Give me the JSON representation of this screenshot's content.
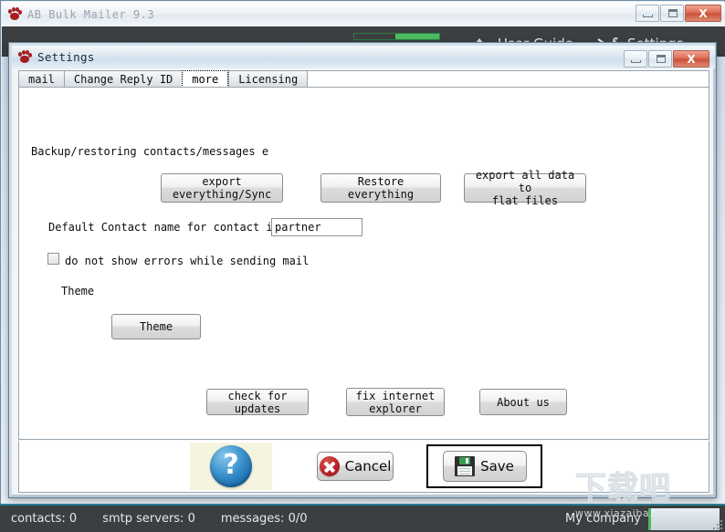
{
  "main_window": {
    "title": "AB Bulk Mailer 9.3",
    "icon": "paw-icon",
    "minimize_label": "",
    "maximize_label": "",
    "close_label": "X"
  },
  "toolbar": {
    "items": [
      {
        "label": "User Guide",
        "icon": "mountain-icon"
      },
      {
        "label": "Settings",
        "icon": "wrench-icon"
      }
    ],
    "progress_percent": 50,
    "progress_color": "#4cb963"
  },
  "dialog": {
    "title": "Settings",
    "icon": "paw-icon",
    "close_label": "X",
    "tabs": [
      {
        "label": "mail",
        "selected": false
      },
      {
        "label": "Change Reply ID",
        "selected": false
      },
      {
        "label": "more",
        "selected": true
      },
      {
        "label": "Licensing",
        "selected": false
      }
    ],
    "content": {
      "backup_label": "Backup/restoring contacts/messages e",
      "buttons_row1": [
        {
          "label": "export\neverything/Sync"
        },
        {
          "label": "Restore everything"
        },
        {
          "label": "export all data to\nflat files"
        }
      ],
      "default_contact_label": "Default Contact name for contact imports",
      "default_contact_value": "partner",
      "default_contact_placeholder": "",
      "checkbox_label": "do not show errors while sending mail",
      "checkbox_checked": false,
      "theme_label": "Theme",
      "theme_button": "Theme",
      "buttons_row2": [
        {
          "label": "check for updates"
        },
        {
          "label": "fix internet\nexplorer"
        },
        {
          "label": "About us"
        }
      ]
    },
    "footer": {
      "help_icon": "question-mark-icon",
      "help_symbol": "?",
      "cancel_label": "Cancel",
      "cancel_icon": "x-circle-icon",
      "save_label": "Save",
      "save_icon": "floppy-disk-icon"
    }
  },
  "statusbar": {
    "contacts": "contacts: 0",
    "smtp_servers": "smtp servers: 0",
    "messages": "messages: 0/0",
    "company": "My company"
  },
  "watermark": {
    "text_cn": "下载吧",
    "url": "www.xiazaiba.com"
  }
}
